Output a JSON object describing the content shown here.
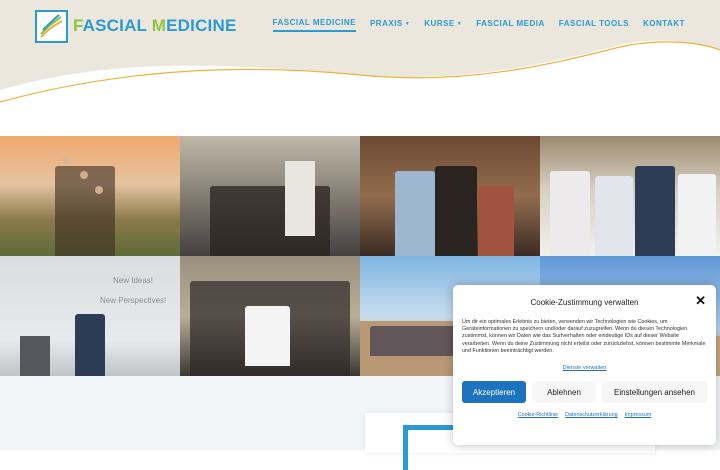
{
  "header": {
    "logo_text_first": "F",
    "logo_text_rest": "ASCIAL ",
    "logo_text_m": "M",
    "logo_text_end": "EDICINE"
  },
  "nav": [
    {
      "label": "FASCIAL MEDICINE",
      "active": true,
      "dropdown": false
    },
    {
      "label": "PRAXIS",
      "active": false,
      "dropdown": true
    },
    {
      "label": "KURSE",
      "active": false,
      "dropdown": true
    },
    {
      "label": "FASCIAL MEDIA",
      "active": false,
      "dropdown": false
    },
    {
      "label": "FASCIAL TOOLS",
      "active": false,
      "dropdown": false
    },
    {
      "label": "KONTAKT",
      "active": false,
      "dropdown": false
    }
  ],
  "gallery": {
    "slide_line1": "New Ideas!",
    "slide_line2": "New Perspectives!"
  },
  "cookie": {
    "title": "Cookie-Zustimmung verwalten",
    "body": "Um dir ein optimales Erlebnis zu bieten, verwenden wir Technologien wie Cookies, um Geräteinformationen zu speichern und/oder darauf zuzugreifen. Wenn du diesen Technologien zustimmst, können wir Daten wie das Surfverhalten oder eindeutige IDs auf dieser Website verarbeiten. Wenn du deine Zustimmung nicht erteilst oder zurückziehst, können bestimmte Merkmale und Funktionen beeinträchtigt werden.",
    "services_link": "Dienste verwalten",
    "accept": "Akzeptieren",
    "deny": "Ablehnen",
    "settings": "Einstellungen ansehen",
    "footer": [
      "Cookie-Richtlinie",
      "Datenschutzerklärung",
      "Impressum"
    ]
  },
  "colors": {
    "accent": "#2a9ad6",
    "logo_green": "#8cc63f",
    "header_bg": "#ebe7dc",
    "button_blue": "#1e73be"
  }
}
